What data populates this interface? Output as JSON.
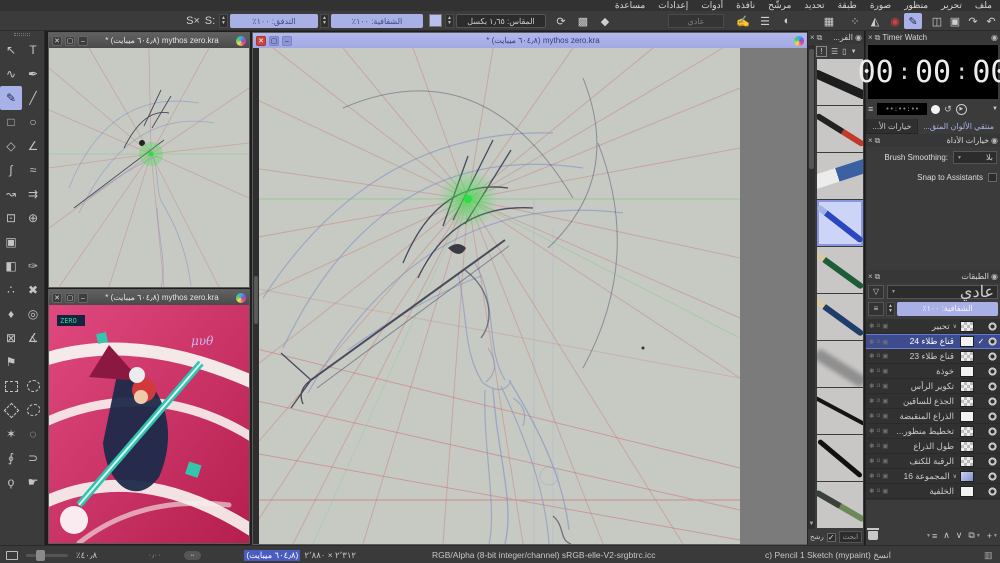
{
  "menu": {
    "items": [
      {
        "label": "ملف"
      },
      {
        "label": "تحرير"
      },
      {
        "label": "منظور"
      },
      {
        "label": "صورة"
      },
      {
        "label": "طبقة"
      },
      {
        "label": "تحديد"
      },
      {
        "label": "مرشّح"
      },
      {
        "label": "نافذة"
      },
      {
        "label": "أدوات"
      },
      {
        "label": "إعدادات"
      },
      {
        "label": "مساعدة"
      }
    ]
  },
  "toolbar": {
    "s_pattern": "S×",
    "s_gradient": "S:",
    "flow": "التدفق: ١٠٠٪",
    "opacity": "الشفافية: ١٠٠٪",
    "size": "المقاس: ١٫٦٥ بكسل",
    "blend": "عادي",
    "reload_glyph": "⟳",
    "checker_glyph": "▩",
    "eraser_glyph": "◆",
    "right_icons": [
      {
        "g": "↶",
        "n": "undo-icon"
      },
      {
        "g": "↷",
        "n": "redo-icon"
      },
      {
        "g": "▣",
        "n": "assistants-icon"
      },
      {
        "g": "◫",
        "n": "wraparound-icon"
      },
      {
        "g": "✎",
        "n": "brush-mode-icon",
        "cls": "hl"
      },
      {
        "g": "◉",
        "n": "record-macro-icon",
        "cls": "rec"
      },
      {
        "g": "◭",
        "n": "mirror-icon"
      },
      {
        "g": "⁘",
        "n": "snap-icon"
      },
      {
        "g": "▦",
        "n": "pattern-icon"
      },
      {
        "g": "◐",
        "n": "fg-bg-colors-icon"
      },
      {
        "g": "☰",
        "n": "brush-presets-icon"
      },
      {
        "g": "✍",
        "n": "edit-brush-settings-icon"
      }
    ]
  },
  "windows": {
    "title": "mythos zero.kra (٦٠٤٫٨ ميبايت) *"
  },
  "timer": {
    "title": "Timer Watch",
    "h": "00",
    "m": "00",
    "s": "00",
    "mini": "••:••:••"
  },
  "tabs": {
    "color": "منتقي الألوان المتق...",
    "tool": "خيارات الأ..."
  },
  "tool_options": {
    "title": "خيارات الأداة",
    "smoothing_label": "Brush Smoothing:",
    "smoothing_value": "بلا",
    "snap_label": "Snap to Assistants"
  },
  "brushes": {
    "title": "الفر...",
    "search": "ابحث",
    "filter": "رشح",
    "filter_check": "✓",
    "items": [
      {
        "cls": "b1",
        "n": "ink-brush"
      },
      {
        "cls": "b2",
        "n": "red-tip-brush"
      },
      {
        "cls": "b3",
        "n": "eraser-preset"
      },
      {
        "cls": "b4 sel",
        "n": "blue-pencil-selected"
      },
      {
        "cls": "b5",
        "n": "green-pencil"
      },
      {
        "cls": "b6",
        "n": "dark-blue-pencil"
      },
      {
        "cls": "b7",
        "n": "smudge-brush"
      },
      {
        "cls": "b8",
        "n": "ink-pen"
      },
      {
        "cls": "b9",
        "n": "marker-pen"
      },
      {
        "cls": "b10",
        "n": "green-brush-pen"
      }
    ]
  },
  "layers": {
    "title": "الطبقات",
    "blend": "عادي",
    "opacity": "الشفافية: ١٠٠٪",
    "rows": [
      {
        "name": "تحبير",
        "thumb": "checker",
        "caret": "∨"
      },
      {
        "name": "قناع طلاء 24",
        "cls": "selected",
        "thumb": "white",
        "check": "✓"
      },
      {
        "name": "قناع طلاء 23",
        "thumb": "checker"
      },
      {
        "name": "خوذة",
        "thumb": "white"
      },
      {
        "name": "تكوير الرأس",
        "thumb": "checker"
      },
      {
        "name": "الجذع للساقين",
        "thumb": "checker"
      },
      {
        "name": "الذراع المنقبضة",
        "thumb": "white"
      },
      {
        "name": "تخطيط منظور...",
        "thumb": "checker"
      },
      {
        "name": "طول الذراع",
        "thumb": "checker"
      },
      {
        "name": "الرقبة للكتف",
        "thumb": "checker"
      },
      {
        "name": "المجموعة 16",
        "thumb": "blue",
        "caret": "∨"
      },
      {
        "name": "الخلفية",
        "thumb": "white"
      }
    ]
  },
  "toolbox": {
    "tools": [
      {
        "g": "↖",
        "n": "select-tool"
      },
      {
        "g": "T",
        "n": "text-tool"
      },
      {
        "g": "∿",
        "n": "edit-shapes-tool"
      },
      {
        "g": "✒",
        "n": "calligraphy-tool"
      },
      {
        "g": "✎",
        "n": "freehand-brush-tool",
        "cls": "sel"
      },
      {
        "g": "╱",
        "n": "line-tool"
      },
      {
        "g": "□",
        "n": "rectangle-tool"
      },
      {
        "g": "○",
        "n": "ellipse-tool"
      },
      {
        "g": "◇",
        "n": "polygon-tool"
      },
      {
        "g": "∠",
        "n": "polyline-tool"
      },
      {
        "g": "∫",
        "n": "bezier-curve-tool"
      },
      {
        "g": "≈",
        "n": "freehand-path-tool"
      },
      {
        "g": "↝",
        "n": "dynamic-brush-tool"
      },
      {
        "g": "⇉",
        "n": "multibrush-tool"
      },
      {
        "g": "⊡",
        "n": "transform-tool"
      },
      {
        "g": "⊕",
        "n": "move-tool"
      },
      {
        "g": "▣",
        "n": "crop-tool"
      },
      {
        "g": "",
        "n": "spacer",
        "cls": "blank"
      },
      {
        "g": "◧",
        "n": "gradient-tool"
      },
      {
        "g": "✑",
        "n": "color-picker-tool"
      },
      {
        "g": "∴",
        "n": "colorize-mask-tool"
      },
      {
        "g": "✖",
        "n": "smart-patch-tool"
      },
      {
        "g": "♦",
        "n": "fill-tool"
      },
      {
        "g": "◎",
        "n": "enclose-fill-tool"
      },
      {
        "g": "⊠",
        "n": "mesh-transform-tool"
      },
      {
        "g": "∡",
        "n": "measure-tool"
      },
      {
        "g": "⚑",
        "n": "reference-images-tool"
      },
      {
        "g": "",
        "n": "spacer",
        "cls": "blank"
      },
      {
        "g": "",
        "n": "rect-select-tool",
        "cls": "shape selrect"
      },
      {
        "g": "",
        "n": "ellipse-select-tool",
        "cls": "shape selellipse"
      },
      {
        "g": "",
        "n": "polygon-select-tool",
        "cls": "shape selpoly"
      },
      {
        "g": "",
        "n": "freehand-select-tool",
        "cls": "shape sellasso"
      },
      {
        "g": "✶",
        "n": "contiguous-select-tool"
      },
      {
        "g": "◌",
        "n": "similar-color-select-tool"
      },
      {
        "g": "∮",
        "n": "bezier-select-tool"
      },
      {
        "g": "⊃",
        "n": "magnetic-select-tool"
      },
      {
        "g": "ϙ",
        "n": "zoom-tool"
      },
      {
        "g": "☛",
        "n": "pan-tool"
      }
    ]
  },
  "status": {
    "zoom": "٤٠٫٨٪",
    "angle": "٠٫٠٠",
    "dims": "٢٬٣١٢ × ٢٬٨٨٠",
    "mem": "(٦٠٤٫٨ ميبايت)",
    "profile": "RGB/Alpha (8-bit integer/channel)  sRGB-elle-V2-srgbtrc.icc",
    "brush": "c) Pencil 1 Sketch (mypaint) انسخ"
  }
}
